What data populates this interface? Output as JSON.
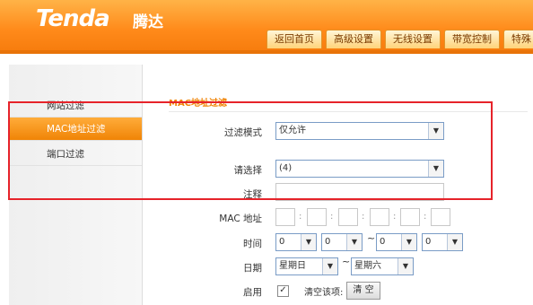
{
  "header": {
    "logo_text": "Tenda",
    "logo_cn": "腾达",
    "nav": [
      "返回首页",
      "高级设置",
      "无线设置",
      "带宽控制",
      "特殊"
    ]
  },
  "sidebar": {
    "items": [
      {
        "label": "网站过滤",
        "active": false
      },
      {
        "label": "MAC地址过滤",
        "active": true
      },
      {
        "label": "端口过滤",
        "active": false
      }
    ]
  },
  "main": {
    "title": "MAC地址过滤",
    "filter_mode": {
      "label": "过滤模式",
      "value": "仅允许"
    },
    "choose": {
      "label": "请选择",
      "value": "(4)"
    },
    "note": {
      "label": "注释",
      "value": ""
    },
    "mac": {
      "label": "MAC 地址",
      "fields": [
        "",
        "",
        "",
        "",
        "",
        ""
      ],
      "separator": ":"
    },
    "time": {
      "label": "时间",
      "values": [
        "0",
        "0",
        "0",
        "0"
      ],
      "range_sep": "~"
    },
    "date": {
      "label": "日期",
      "start": "星期日",
      "end": "星期六",
      "range_sep": "~"
    },
    "enable": {
      "label": "启用",
      "checked": true,
      "check_mark": "✓"
    },
    "clear": {
      "label": "清空该项:",
      "button": "清 空"
    }
  },
  "colors": {
    "accent": "#f08406",
    "highlight": "#e6232a"
  }
}
